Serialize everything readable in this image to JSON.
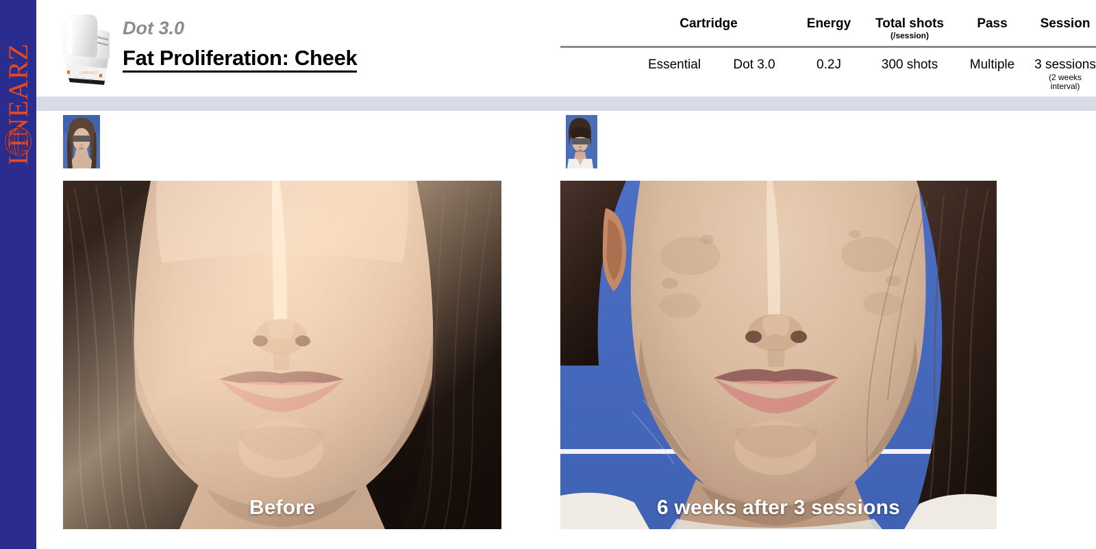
{
  "brand": {
    "wordmark": "LINEARZ",
    "rail_color": "#2b2d8e",
    "accent_color": "#e8491c",
    "globe_icon": "globe-sphere-icon"
  },
  "header": {
    "device_icon": "handpiece-cartridge-icon",
    "subtitle": "Dot 3.0",
    "title": "Fat Proliferation: Cheek",
    "subtitle_color": "#8d8d8d",
    "title_color": "#000000"
  },
  "parameters": {
    "columns": [
      {
        "label": "Cartridge",
        "sub": ""
      },
      {
        "label": "Energy",
        "sub": ""
      },
      {
        "label": "Total shots",
        "sub": "(/session)"
      },
      {
        "label": "Pass",
        "sub": ""
      },
      {
        "label": "Session",
        "sub": ""
      }
    ],
    "values": {
      "cartridge_type": "Essential",
      "cartridge_model": "Dot 3.0",
      "energy": "0.2J",
      "total_shots": "300 shots",
      "pass": "Multiple",
      "session": "3 sessions",
      "session_sub": "(2 weeks interval)"
    },
    "rule_color": "#8a8a8a"
  },
  "divider": {
    "color": "#d6dbe5"
  },
  "panels": [
    {
      "id": "before",
      "caption": "Before",
      "thumbnail_name": "patient-thumbnail-before",
      "photo_name": "clinical-photo-before",
      "background_color": "#4a6fb5",
      "has_censor_bar": true
    },
    {
      "id": "after",
      "caption": "6 weeks after 3 sessions",
      "thumbnail_name": "patient-thumbnail-after",
      "photo_name": "clinical-photo-after",
      "background_color": "#4a6fb5",
      "has_censor_bar": true
    }
  ]
}
